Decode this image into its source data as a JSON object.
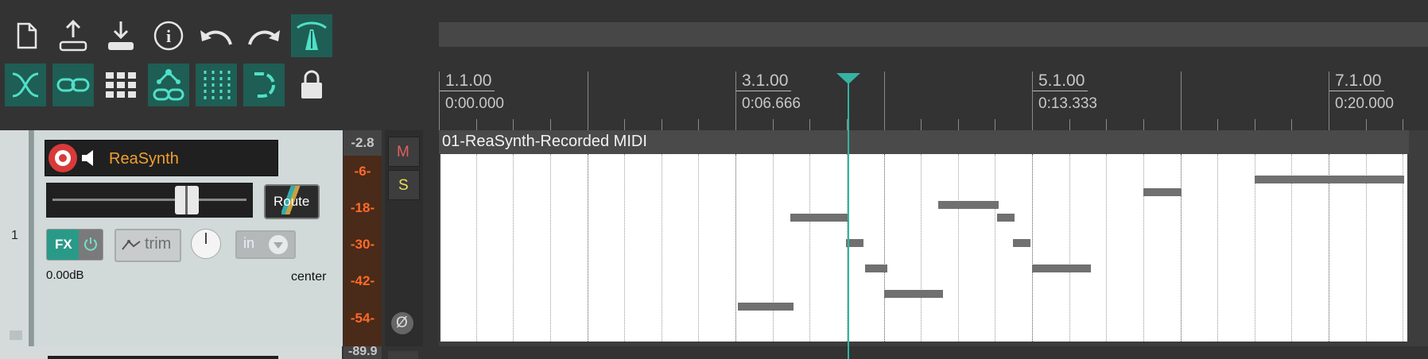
{
  "toolbar": {
    "row1": [
      {
        "name": "new-project-icon",
        "active": false
      },
      {
        "name": "open-project-icon",
        "active": false
      },
      {
        "name": "save-project-icon",
        "active": false
      },
      {
        "name": "project-info-icon",
        "active": false
      },
      {
        "name": "undo-icon",
        "active": false
      },
      {
        "name": "redo-icon",
        "active": false
      },
      {
        "name": "metronome-icon",
        "active": true
      }
    ],
    "row2": [
      {
        "name": "auto-crossfade-icon",
        "active": true
      },
      {
        "name": "link-icon",
        "active": true
      },
      {
        "name": "grid-icon",
        "active": false
      },
      {
        "name": "ripple-edit-icon",
        "active": true
      },
      {
        "name": "snap-icon",
        "active": true
      },
      {
        "name": "loop-icon",
        "active": true
      },
      {
        "name": "lock-icon",
        "active": false
      }
    ]
  },
  "ruler": {
    "markers": [
      {
        "label": "1.1.00",
        "time": "0:00.000"
      },
      {
        "label": "3.1.00",
        "time": "0:06.666"
      },
      {
        "label": "5.1.00",
        "time": "0:13.333"
      },
      {
        "label": "7.1.00",
        "time": "0:20.000"
      }
    ]
  },
  "track": {
    "number": "1",
    "name": "ReaSynth",
    "volume_db": "0.00dB",
    "pan": "center",
    "route_label": "Route",
    "fx_label": "FX",
    "trim_label": "trim",
    "input_label": "in",
    "mute_label": "M",
    "solo_label": "S",
    "phase_label": "Ø",
    "fader_level": 0.72
  },
  "meter": {
    "peak": "-2.8",
    "scale": [
      "-6-",
      "-18-",
      "-30-",
      "-42-",
      "-54-"
    ],
    "next_peak": "-89.9"
  },
  "item": {
    "title": "01-ReaSynth-Recorded MIDI"
  },
  "colors": {
    "accent": "#36b3a2",
    "track_name": "#f0a030",
    "meter_text": "#ff6a2a",
    "toolbar_active": "#1f5e54"
  }
}
